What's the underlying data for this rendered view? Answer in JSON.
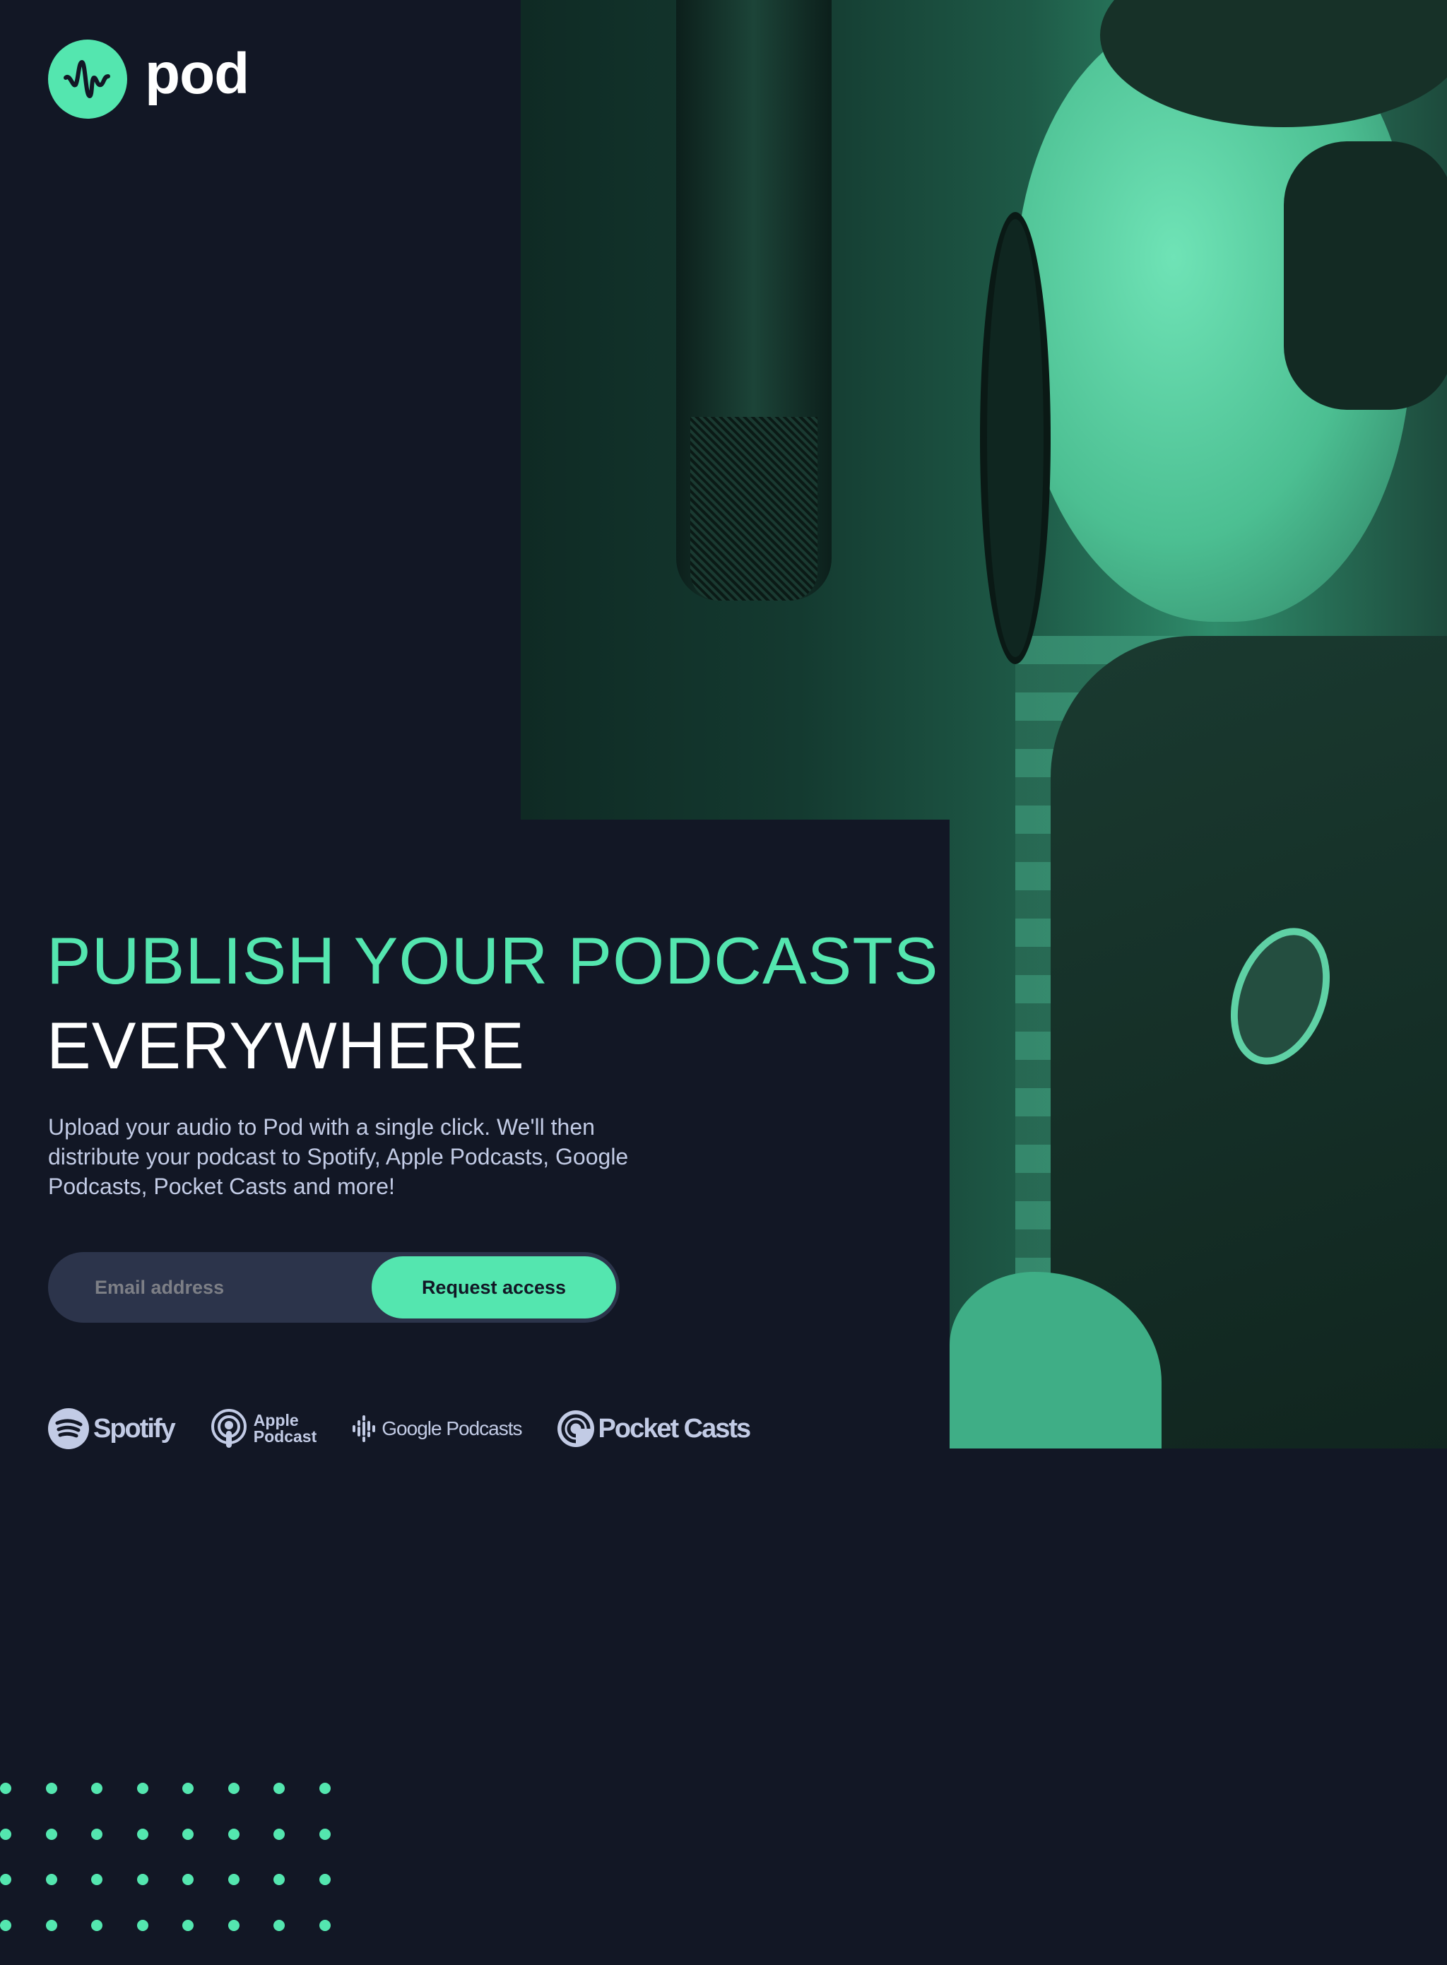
{
  "brand": {
    "name": "pod",
    "accent": "#54e6af",
    "background": "#121725"
  },
  "hero": {
    "headline_line1": "PUBLISH YOUR PODCASTS",
    "headline_line2": "EVERYWHERE",
    "description": "Upload your audio to Pod with a single click. We'll then distribute your podcast to Spotify, Apple Podcasts, Google Podcasts, Pocket Casts and more!"
  },
  "form": {
    "email_placeholder": "Email address",
    "email_value": "",
    "submit_label": "Request access"
  },
  "platforms": {
    "spotify": "Spotify",
    "apple_line1": "Apple",
    "apple_line2": "Podcast",
    "google": "Google Podcasts",
    "pocketcasts": "Pocket Casts"
  }
}
